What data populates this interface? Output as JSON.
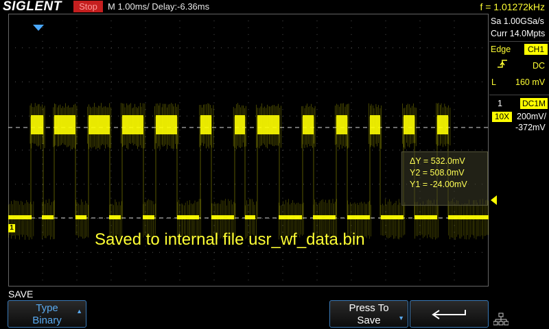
{
  "topbar": {
    "logo": "SIGLENT",
    "run_state": "Stop",
    "timebase": "M 1.00ms/ Delay:-6.36ms",
    "frequency": "f = 1.01272kHz"
  },
  "channel_marker": "1",
  "cursors": {
    "delta_y": "ΔY = 532.0mV",
    "y2": "Y2 = 508.0mV",
    "y1": "Y1 = -24.00mV"
  },
  "message": "Saved to internal file usr_wf_data.bin",
  "side_panel": {
    "sample_rate": "Sa 1.00GSa/s",
    "memory": "Curr 14.0Mpts",
    "trigger_type": "Edge",
    "trigger_source": "CH1",
    "trigger_coupling": "DC",
    "trigger_level_label": "L",
    "trigger_level": "160 mV",
    "channel_number": "1",
    "channel_coupling": "DC1M",
    "probe": "10X",
    "volts_per_div": "200mV/",
    "offset": "-372mV"
  },
  "menu": {
    "title": "SAVE",
    "type_label": "Type",
    "type_value": "Binary",
    "press_line1": "Press To",
    "press_line2": "Save"
  },
  "colors": {
    "trace": "#ffff00",
    "accent_blue": "#3a7ab8",
    "run_state_bg": "#c51f1f"
  }
}
